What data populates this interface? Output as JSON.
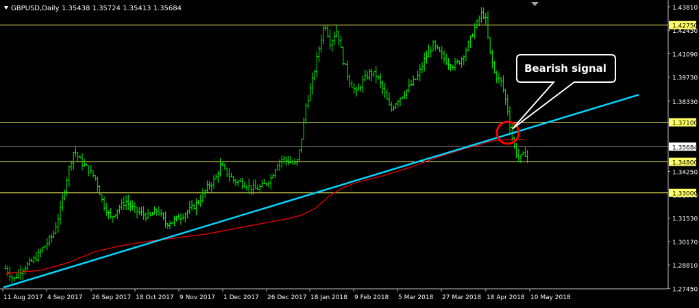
{
  "header": {
    "symbol_label": "GBPUSD,Daily",
    "ohlc": "1.35438 1.35724 1.35413 1.35684"
  },
  "colors": {
    "background": "#000000",
    "grid_frame": "#c0c0c0",
    "candles": "#00ff00",
    "horizontal_lines": "#ffff66",
    "trendline": "#00d7ff",
    "moving_average": "#ff0000",
    "signal_circle": "#ff0000",
    "callout_bg": "#000000",
    "callout_text": "#ffffff"
  },
  "chart_data": {
    "type": "ohlc",
    "ylim": [
      1.2746,
      1.4405
    ],
    "y_ticks": [
      "1.43810",
      "1.42450",
      "1.41090",
      "1.39730",
      "1.38330",
      "1.37100",
      "1.35684",
      "1.34250",
      "1.32890",
      "1.31530",
      "1.30170",
      "1.28810",
      "1.27450"
    ],
    "x_ticks": [
      "11 Aug 2017",
      "4 Sep 2017",
      "26 Sep 2017",
      "18 Oct 2017",
      "9 Nov 2017",
      "1 Dec 2017",
      "26 Dec 2017",
      "18 Jan 2018",
      "9 Feb 2018",
      "5 Mar 2018",
      "27 Mar 2018",
      "18 Apr 2018",
      "10 May 2018"
    ],
    "price_path": [
      [
        0,
        1.299
      ],
      [
        6,
        1.287
      ],
      [
        14,
        1.283
      ],
      [
        20,
        1.2795
      ],
      [
        28,
        1.284
      ],
      [
        40,
        1.288
      ],
      [
        52,
        1.292
      ],
      [
        65,
        1.299
      ],
      [
        78,
        1.306
      ],
      [
        88,
        1.32
      ],
      [
        100,
        1.343
      ],
      [
        108,
        1.355
      ],
      [
        118,
        1.348
      ],
      [
        128,
        1.344
      ],
      [
        140,
        1.338
      ],
      [
        150,
        1.324
      ],
      [
        162,
        1.315
      ],
      [
        172,
        1.321
      ],
      [
        184,
        1.325
      ],
      [
        196,
        1.32
      ],
      [
        206,
        1.318
      ],
      [
        218,
        1.316
      ],
      [
        230,
        1.32
      ],
      [
        242,
        1.312
      ],
      [
        254,
        1.314
      ],
      [
        266,
        1.317
      ],
      [
        280,
        1.321
      ],
      [
        292,
        1.326
      ],
      [
        302,
        1.333
      ],
      [
        314,
        1.338
      ],
      [
        322,
        1.346
      ],
      [
        332,
        1.341
      ],
      [
        342,
        1.337
      ],
      [
        352,
        1.336
      ],
      [
        362,
        1.334
      ],
      [
        372,
        1.332
      ],
      [
        384,
        1.334
      ],
      [
        396,
        1.339
      ],
      [
        404,
        1.347
      ],
      [
        412,
        1.35
      ],
      [
        424,
        1.348
      ],
      [
        432,
        1.346
      ],
      [
        438,
        1.356
      ],
      [
        446,
        1.38
      ],
      [
        456,
        1.395
      ],
      [
        466,
        1.415
      ],
      [
        474,
        1.429
      ],
      [
        482,
        1.417
      ],
      [
        492,
        1.425
      ],
      [
        500,
        1.408
      ],
      [
        510,
        1.395
      ],
      [
        520,
        1.388
      ],
      [
        530,
        1.395
      ],
      [
        540,
        1.4
      ],
      [
        550,
        1.398
      ],
      [
        560,
        1.389
      ],
      [
        570,
        1.378
      ],
      [
        580,
        1.384
      ],
      [
        590,
        1.388
      ],
      [
        600,
        1.393
      ],
      [
        610,
        1.398
      ],
      [
        620,
        1.408
      ],
      [
        632,
        1.416
      ],
      [
        642,
        1.411
      ],
      [
        652,
        1.406
      ],
      [
        662,
        1.404
      ],
      [
        672,
        1.407
      ],
      [
        682,
        1.415
      ],
      [
        692,
        1.425
      ],
      [
        702,
        1.434
      ],
      [
        708,
        1.433
      ],
      [
        714,
        1.413
      ],
      [
        722,
        1.399
      ],
      [
        732,
        1.394
      ],
      [
        740,
        1.38
      ],
      [
        746,
        1.364
      ],
      [
        752,
        1.354
      ],
      [
        758,
        1.35
      ],
      [
        764,
        1.352
      ],
      [
        770,
        1.354
      ],
      [
        774,
        1.356
      ]
    ],
    "moving_average": [
      [
        8,
        1.283
      ],
      [
        30,
        1.284
      ],
      [
        60,
        1.285
      ],
      [
        100,
        1.2895
      ],
      [
        140,
        1.296
      ],
      [
        180,
        1.2995
      ],
      [
        220,
        1.302
      ],
      [
        260,
        1.304
      ],
      [
        300,
        1.306
      ],
      [
        340,
        1.309
      ],
      [
        380,
        1.312
      ],
      [
        420,
        1.315
      ],
      [
        440,
        1.317
      ],
      [
        460,
        1.321
      ],
      [
        480,
        1.328
      ],
      [
        500,
        1.333
      ],
      [
        520,
        1.336
      ],
      [
        560,
        1.34
      ],
      [
        600,
        1.345
      ],
      [
        640,
        1.351
      ],
      [
        680,
        1.356
      ],
      [
        700,
        1.358
      ],
      [
        715,
        1.36
      ],
      [
        740,
        1.361
      ],
      [
        765,
        1.361
      ]
    ],
    "trendline": {
      "start": [
        5,
        1.275
      ],
      "end": [
        932,
        1.387
      ]
    },
    "horizontal_levels": [
      {
        "label": "1.42750",
        "value": 1.4275
      },
      {
        "label": "1.37100",
        "value": 1.371
      },
      {
        "label": "1.34800",
        "value": 1.348
      },
      {
        "label": "1.33000",
        "value": 1.33
      }
    ],
    "current_price": {
      "label": "1.35684",
      "value": 1.35684
    },
    "annotation": {
      "text": "Bearish signal"
    }
  }
}
